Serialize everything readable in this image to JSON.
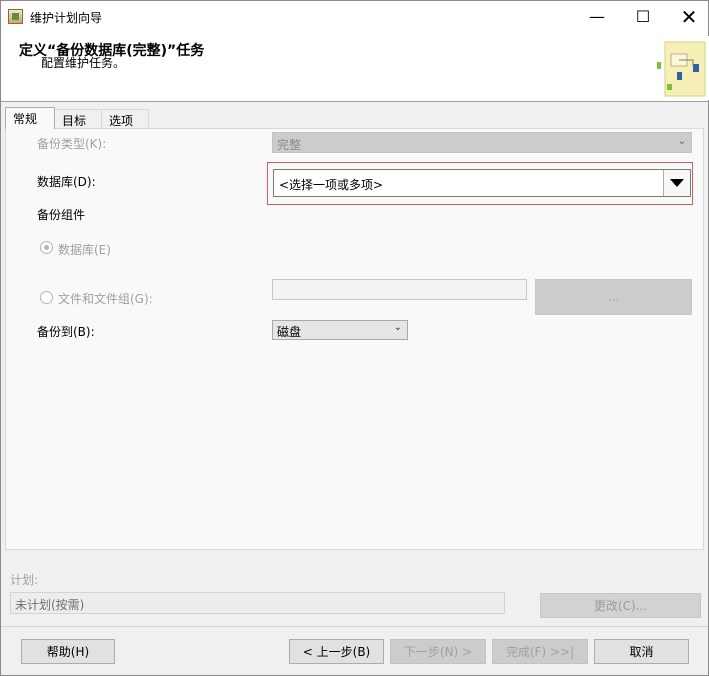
{
  "window": {
    "title": "维护计划向导",
    "controls": {
      "minimize": "—",
      "maximize": "☐",
      "close": "✕"
    }
  },
  "header": {
    "title": "定义“备份数据库(完整)”任务",
    "subtitle": "配置维护任务。"
  },
  "tabs": [
    {
      "label": "常规",
      "active": true
    },
    {
      "label": "目标",
      "active": false
    },
    {
      "label": "选项",
      "active": false
    }
  ],
  "general": {
    "backup_type_label": "备份类型(K):",
    "backup_type_value": "完整",
    "database_label": "数据库(D):",
    "database_value": "<选择一项或多项>",
    "backup_component_label": "备份组件",
    "radio_database_label": "数据库(E)",
    "radio_files_label": "文件和文件组(G):",
    "browse_label": "...",
    "backup_to_label": "备份到(B):",
    "backup_to_value": "磁盘"
  },
  "schedule": {
    "label": "计划:",
    "value": "未计划(按需)",
    "change_label": "更改(C)..."
  },
  "buttons": {
    "help": "帮助(H)",
    "prev": "< 上一步(B)",
    "next": "下一步(N) >",
    "finish": "完成(F) >>|",
    "cancel": "取消"
  },
  "colors": {
    "highlight": "#e05a5a",
    "disabled_text": "#a0a0a0"
  }
}
